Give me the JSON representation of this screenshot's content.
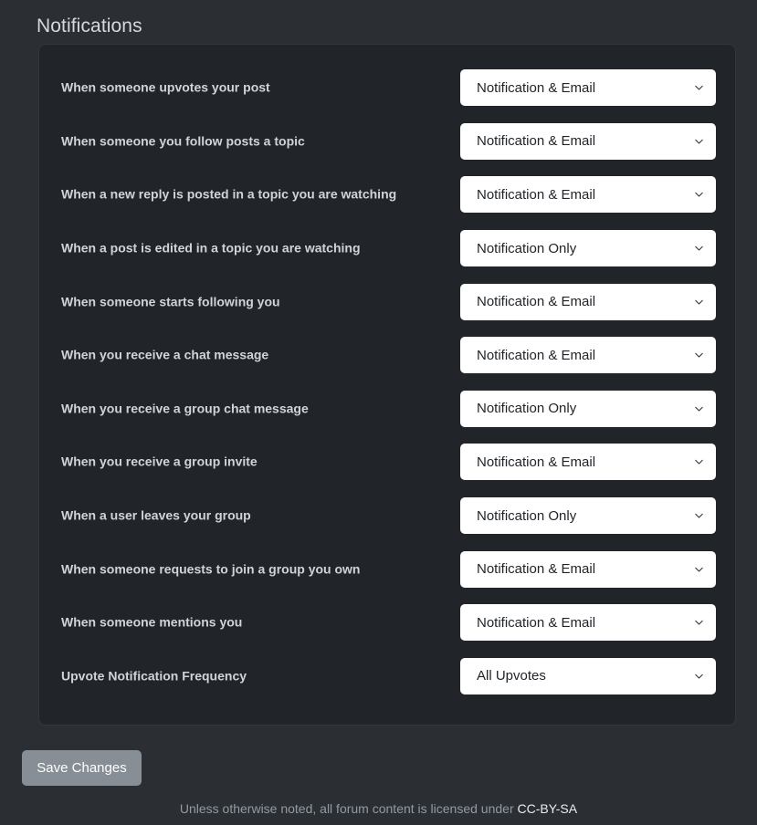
{
  "page": {
    "title": "Notifications",
    "background_color": "#2b2f34",
    "card_background_color": "#212529"
  },
  "settings": {
    "rows": [
      {
        "label": "When someone upvotes your post",
        "value": "Notification & Email"
      },
      {
        "label": "When someone you follow posts a topic",
        "value": "Notification & Email"
      },
      {
        "label": "When a new reply is posted in a topic you are watching",
        "value": "Notification & Email"
      },
      {
        "label": "When a post is edited in a topic you are watching",
        "value": "Notification Only"
      },
      {
        "label": "When someone starts following you",
        "value": "Notification & Email"
      },
      {
        "label": "When you receive a chat message",
        "value": "Notification & Email"
      },
      {
        "label": "When you receive a group chat message",
        "value": "Notification Only"
      },
      {
        "label": "When you receive a group invite",
        "value": "Notification & Email"
      },
      {
        "label": "When a user leaves your group",
        "value": "Notification Only"
      },
      {
        "label": "When someone requests to join a group you own",
        "value": "Notification & Email"
      },
      {
        "label": "When someone mentions you",
        "value": "Notification & Email"
      },
      {
        "label": "Upvote Notification Frequency",
        "value": "All Upvotes"
      }
    ],
    "select_icon": "chevron-down-icon"
  },
  "actions": {
    "save_label": "Save Changes",
    "save_button_color": "#878e95"
  },
  "footer": {
    "text": "Unless otherwise noted, all forum content is licensed under",
    "license_link": "CC-BY-SA",
    "link_color": "#e9ecef"
  }
}
